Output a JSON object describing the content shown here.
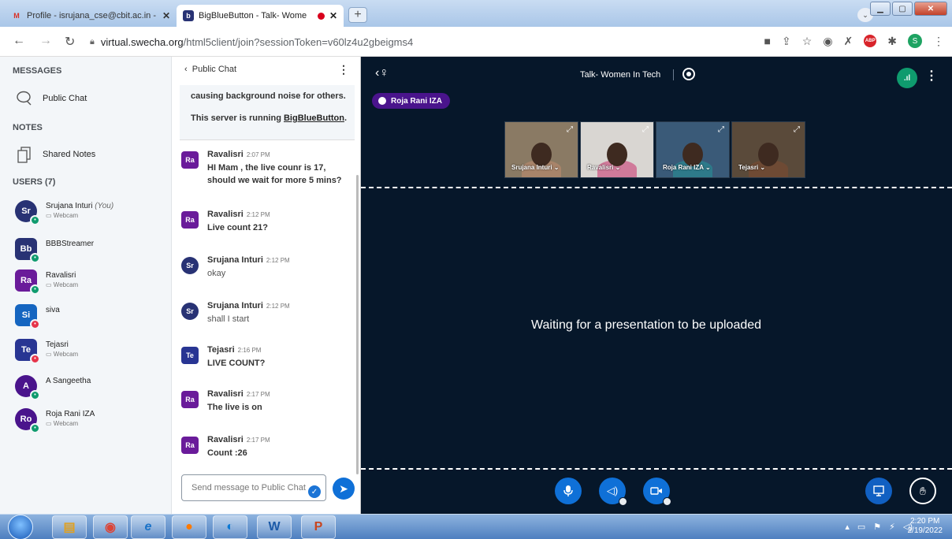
{
  "browser": {
    "tabs": [
      {
        "title": "Profile - isrujana_cse@cbit.ac.in -",
        "icon": "gmail-icon"
      },
      {
        "title": "BigBlueButton - Talk- Wome",
        "icon": "bigbluebutton-icon"
      }
    ],
    "new_tab": "+",
    "url_host": "virtual.swecha.org",
    "url_path": "/html5client/join?sessionToken=v60lz4u2gbeigms4",
    "profile_initial": "S",
    "abp_label": "ABP"
  },
  "sidebar": {
    "messages_heading": "MESSAGES",
    "public_chat_label": "Public Chat",
    "notes_heading": "NOTES",
    "shared_notes_label": "Shared Notes",
    "users_heading": "USERS (7)",
    "users": [
      {
        "initials": "Sr",
        "name": "Srujana Inturi",
        "you": "(You)",
        "sub": "Webcam",
        "color": "#283274",
        "shape": "round",
        "status": "on"
      },
      {
        "initials": "Bb",
        "name": "BBBStreamer",
        "you": "",
        "sub": "",
        "color": "#283274",
        "shape": "square",
        "status": "on"
      },
      {
        "initials": "Ra",
        "name": "Ravalisri",
        "you": "",
        "sub": "Webcam",
        "color": "#6a1b9a",
        "shape": "square",
        "status": "on"
      },
      {
        "initials": "Si",
        "name": "siva",
        "you": "",
        "sub": "",
        "color": "#1565c0",
        "shape": "square",
        "status": "off"
      },
      {
        "initials": "Te",
        "name": "Tejasri",
        "you": "",
        "sub": "Webcam",
        "color": "#283593",
        "shape": "square",
        "status": "off"
      },
      {
        "initials": "A",
        "name": "A Sangeetha",
        "you": "",
        "sub": "",
        "color": "#4a148c",
        "shape": "round",
        "status": "on"
      },
      {
        "initials": "Ro",
        "name": "Roja Rani IZA",
        "you": "",
        "sub": "Webcam",
        "color": "#4a148c",
        "shape": "round",
        "status": "on"
      }
    ]
  },
  "chat": {
    "header": "Public Chat",
    "welcome_line1": "causing background noise for others.",
    "welcome_line2_prefix": "This server is running ",
    "welcome_link": "BigBlueButton",
    "welcome_line2_suffix": ".",
    "messages": [
      {
        "initials": "Ra",
        "name": "Ravalisri",
        "time": "2:07 PM",
        "text": "HI Mam , the live counr is 17, should we wait for more 5 mins?",
        "color": "#6a1b9a",
        "shape": "square",
        "bold": true
      },
      {
        "initials": "Ra",
        "name": "Ravalisri",
        "time": "2:12 PM",
        "text": "Live count 21?",
        "color": "#6a1b9a",
        "shape": "square",
        "bold": true
      },
      {
        "initials": "Sr",
        "name": "Srujana Inturi",
        "time": "2:12 PM",
        "text": "okay",
        "color": "#283274",
        "shape": "round",
        "bold": false
      },
      {
        "initials": "Sr",
        "name": "Srujana Inturi",
        "time": "2:12 PM",
        "text": "shall I start",
        "color": "#283274",
        "shape": "round",
        "bold": false
      },
      {
        "initials": "Te",
        "name": "Tejasri",
        "time": "2:16 PM",
        "text": "LIVE COUNT?",
        "color": "#283593",
        "shape": "square",
        "bold": true
      },
      {
        "initials": "Ra",
        "name": "Ravalisri",
        "time": "2:17 PM",
        "text": "The live is on",
        "color": "#6a1b9a",
        "shape": "square",
        "bold": true
      },
      {
        "initials": "Ra",
        "name": "Ravalisri",
        "time": "2:17 PM",
        "text": "Count :26",
        "color": "#6a1b9a",
        "shape": "square",
        "bold": true
      }
    ],
    "input_placeholder": "Send message to Public Chat"
  },
  "stage": {
    "meeting_title": "Talk- Women In Tech",
    "talking_indicator": "Roja Rani IZA",
    "videos": [
      {
        "name": "Srujana Inturi",
        "bg": "#8a7a64",
        "shirt": "#a8846a"
      },
      {
        "name": "Ravalisri",
        "bg": "#d9d6d2",
        "shirt": "#d07a9a"
      },
      {
        "name": "Roja Rani IZA",
        "bg": "#3a5a78",
        "shirt": "#2e7a8a"
      },
      {
        "name": "Tejasri",
        "bg": "#5a4a3a",
        "shirt": "#6e4a34"
      }
    ],
    "waiting_text": "Waiting for a presentation to be uploaded",
    "connection_label": ".ıl"
  },
  "taskbar": {
    "clock_time": "2:20 PM",
    "clock_date": "2/19/2022"
  }
}
